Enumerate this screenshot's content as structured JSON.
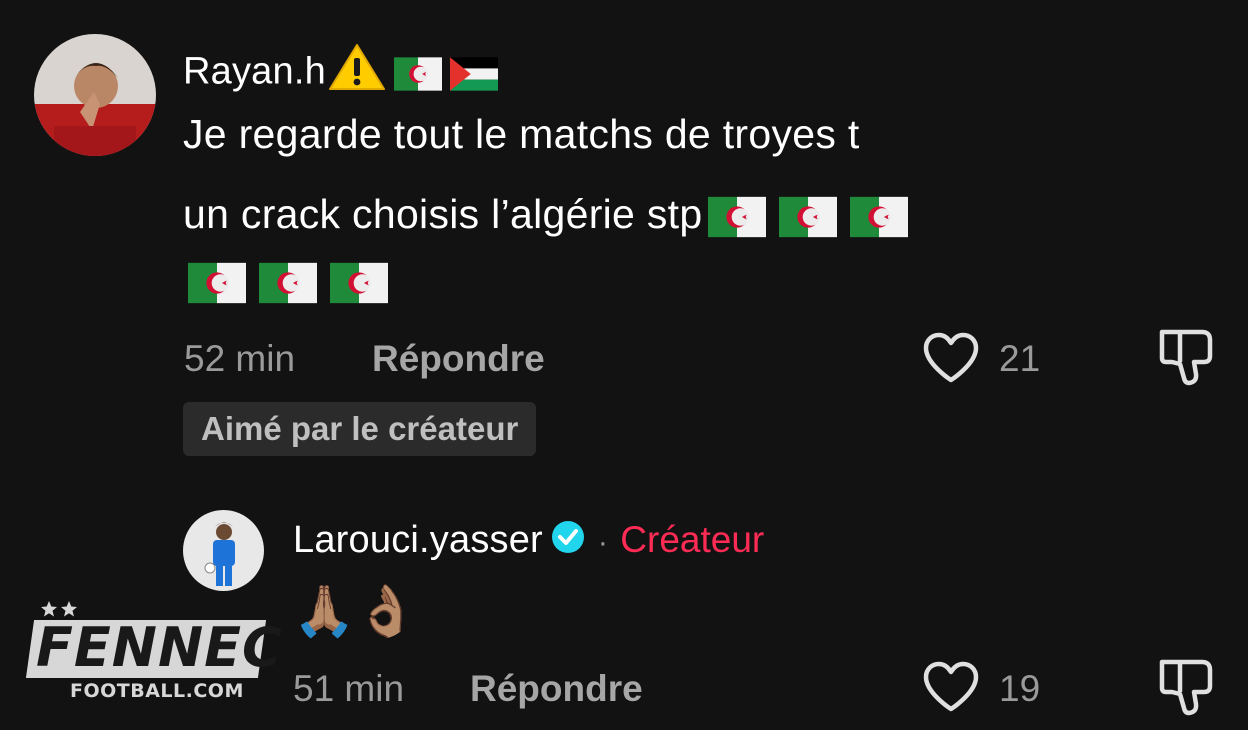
{
  "comment1": {
    "username": "Rayan.h",
    "text_line1": "Je regarde tout le matchs de troyes t",
    "text_line2": "un crack choisis l’algérie stp",
    "time": "52 min",
    "reply_label": "Répondre",
    "like_count": "21",
    "liked_badge": "Aimé par le créateur"
  },
  "comment2": {
    "username": "Larouci.yasser",
    "separator": "·",
    "creator_label": "Créateur",
    "emoji_text": "🙏🏽👌🏽",
    "time": "51 min",
    "reply_label": "Répondre",
    "like_count": "19"
  },
  "watermark": {
    "title": "FENNEC",
    "subtitle": "FOOTBALL.COM"
  },
  "colors": {
    "background": "#121212",
    "creator_accent": "#fe2c55",
    "verified": "#20d5ec"
  }
}
